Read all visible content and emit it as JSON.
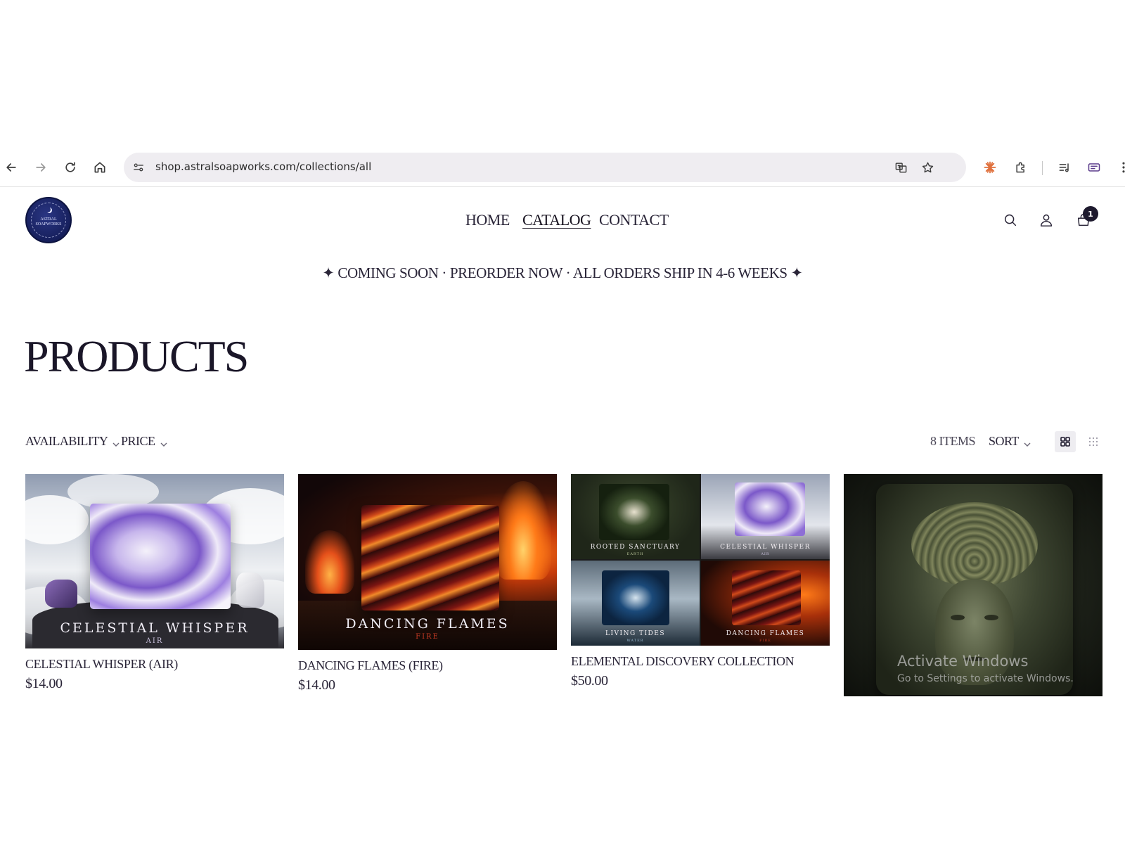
{
  "browser": {
    "url": "shop.astralsoapworks.com/collections/all"
  },
  "store": {
    "logo_text_line1": "ASTRAL",
    "logo_text_line2": "SOAPWORKS",
    "nav": [
      {
        "label": "HOME",
        "active": false
      },
      {
        "label": "CATALOG",
        "active": true
      },
      {
        "label": "CONTACT",
        "active": false
      }
    ],
    "cart_count": "1",
    "announcement": "✦ COMING SOON · PREORDER NOW · ALL ORDERS SHIP IN 4-6 WEEKS ✦"
  },
  "page": {
    "title": "PRODUCTS"
  },
  "toolbar": {
    "filters": [
      "AVAILABILITY",
      "PRICE"
    ],
    "item_count": "8 ITEMS",
    "sort_label": "SORT"
  },
  "products": [
    {
      "title": "CELESTIAL WHISPER (AIR)",
      "price": "$14.00",
      "image_caption": "CELESTIAL WHISPER",
      "image_sub": "AIR"
    },
    {
      "title": "DANCING FLAMES (FIRE)",
      "price": "$14.00",
      "image_caption": "DANCING FLAMES",
      "image_sub": "FIRE"
    },
    {
      "title": "ELEMENTAL DISCOVERY COLLECTION",
      "price": "$50.00",
      "tiles": [
        {
          "caption": "ROOTED SANCTUARY",
          "sub": "EARTH"
        },
        {
          "caption": "CELESTIAL WHISPER",
          "sub": "AIR"
        },
        {
          "caption": "LIVING TIDES",
          "sub": "WATER"
        },
        {
          "caption": "DANCING FLAMES",
          "sub": "FIRE"
        }
      ]
    },
    {
      "title": "",
      "price": ""
    }
  ],
  "os_watermark": {
    "line1": "Activate Windows",
    "line2": "Go to Settings to activate Windows."
  },
  "colors": {
    "text_dark": "#1e1a2e",
    "omnibox_bg": "#efedf1",
    "logo_navy": "#161f5c",
    "air_purple": "#7b58c9",
    "fire_red": "#b3231b"
  }
}
